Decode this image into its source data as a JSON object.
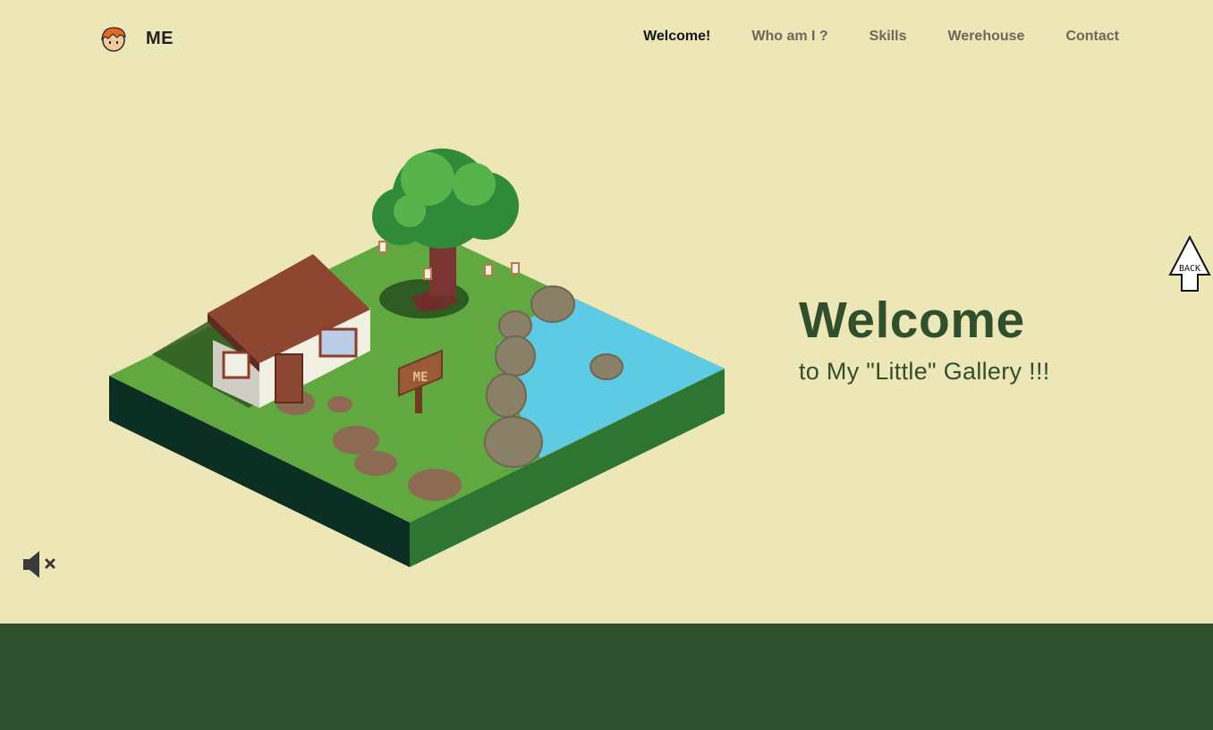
{
  "brand": {
    "name": "ME",
    "avatar_icon": "character-face-icon"
  },
  "nav": {
    "items": [
      {
        "label": "Welcome!",
        "active": true
      },
      {
        "label": "Who am I ?",
        "active": false
      },
      {
        "label": "Skills",
        "active": false
      },
      {
        "label": "Werehouse",
        "active": false
      },
      {
        "label": "Contact",
        "active": false
      }
    ]
  },
  "hero": {
    "title": "Welcome",
    "subtitle": "to My \"Little\" Gallery !!!"
  },
  "scene": {
    "sign_text": "ME"
  },
  "back_button": {
    "label": "BACK",
    "icon": "arrow-up-icon"
  },
  "mute_button": {
    "icon": "speaker-muted-icon"
  },
  "colors": {
    "background": "#ede6b6",
    "accent": "#30502c",
    "footer": "#30502e",
    "grass": "#62a840",
    "water": "#5ecbe4"
  }
}
